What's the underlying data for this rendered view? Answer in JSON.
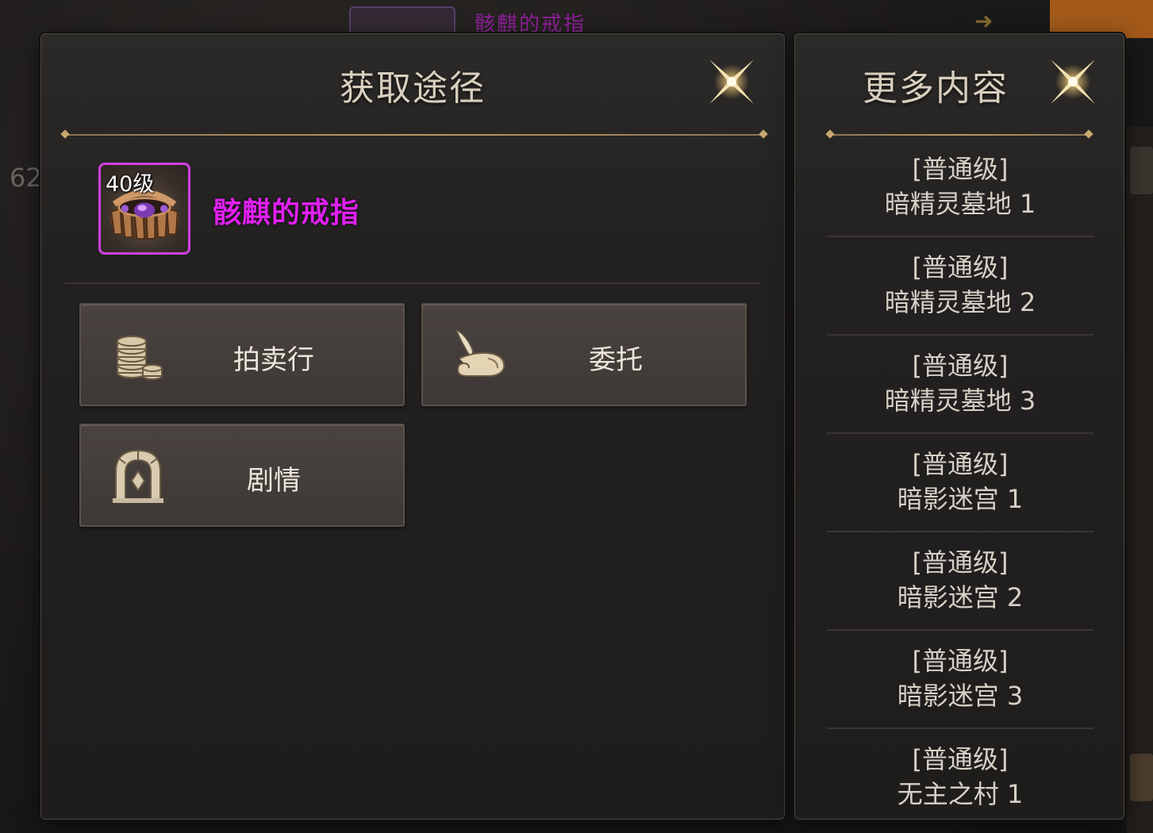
{
  "background": {
    "top_name": "骸麒的戒指",
    "left_number": "62"
  },
  "main_panel": {
    "title": "获取途径",
    "item": {
      "level": "40级",
      "name": "骸麒的戒指",
      "name_color": "#e020f0"
    },
    "sources": [
      {
        "label": "拍卖行",
        "icon": "coins-icon"
      },
      {
        "label": "委托",
        "icon": "scroll-quill-icon"
      },
      {
        "label": "剧情",
        "icon": "archway-icon"
      }
    ]
  },
  "side_panel": {
    "title": "更多内容",
    "items": [
      {
        "grade": "[普通级]",
        "stage": "暗精灵墓地 1"
      },
      {
        "grade": "[普通级]",
        "stage": "暗精灵墓地 2"
      },
      {
        "grade": "[普通级]",
        "stage": "暗精灵墓地 3"
      },
      {
        "grade": "[普通级]",
        "stage": "暗影迷宫 1"
      },
      {
        "grade": "[普通级]",
        "stage": "暗影迷宫 2"
      },
      {
        "grade": "[普通级]",
        "stage": "暗影迷宫 3"
      },
      {
        "grade": "[普通级]",
        "stage": "无主之村 1"
      }
    ]
  },
  "colors": {
    "accent_gold": "#c8a870",
    "item_rarity_purple": "#d040e0",
    "panel_bg": "#222020"
  }
}
